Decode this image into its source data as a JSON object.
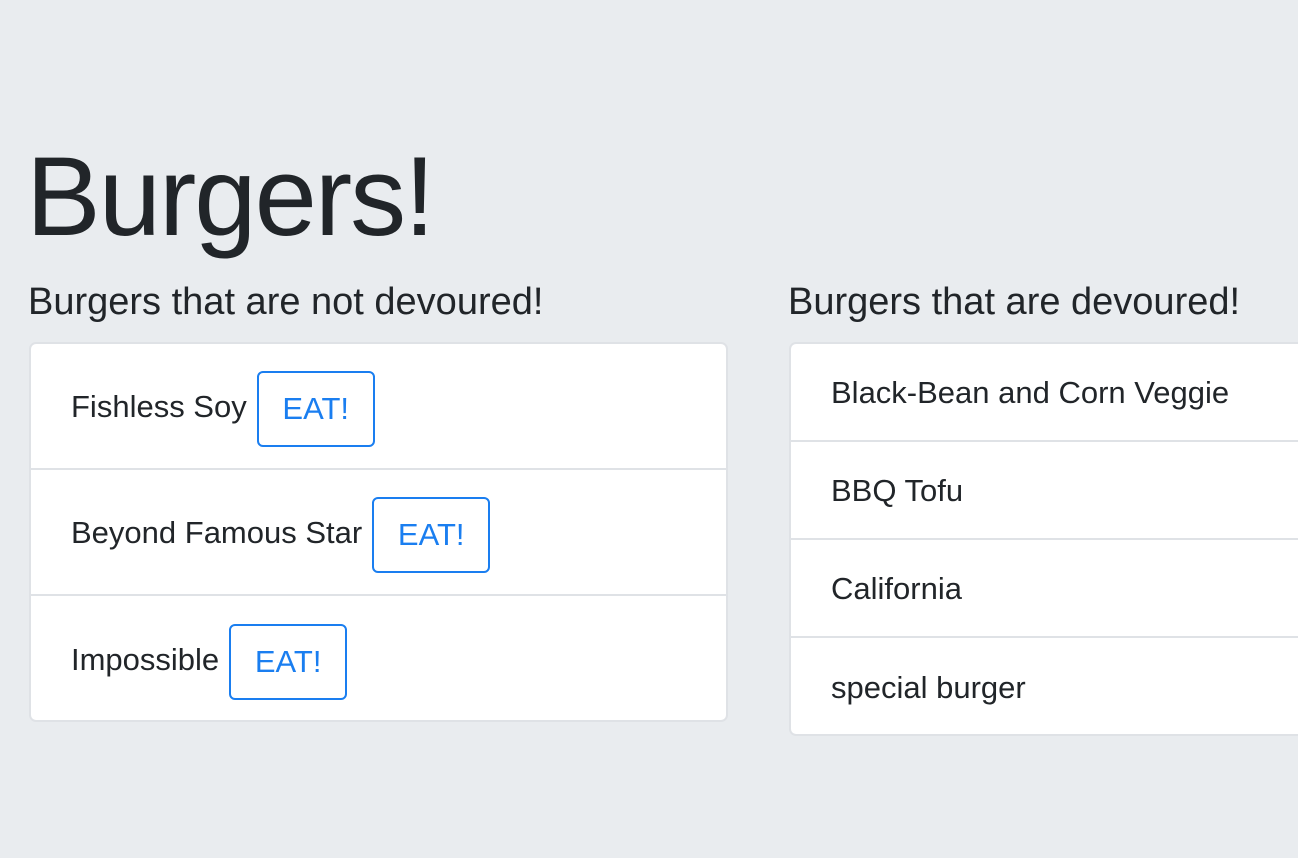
{
  "page": {
    "title": "Burgers!"
  },
  "not_devoured": {
    "heading": "Burgers that are not devoured!",
    "items": [
      {
        "name": "Fishless Soy",
        "button_label": "EAT!"
      },
      {
        "name": "Beyond Famous Star",
        "button_label": "EAT!"
      },
      {
        "name": "Impossible",
        "button_label": "EAT!"
      }
    ]
  },
  "devoured": {
    "heading": "Burgers that are devoured!",
    "items": [
      {
        "name": "Black-Bean and Corn Veggie"
      },
      {
        "name": "BBQ Tofu"
      },
      {
        "name": "California"
      },
      {
        "name": "special burger"
      }
    ]
  },
  "colors": {
    "background": "#e9ecef",
    "accent": "#1a7ef0",
    "text": "#212529",
    "border": "#dfe2e6"
  }
}
